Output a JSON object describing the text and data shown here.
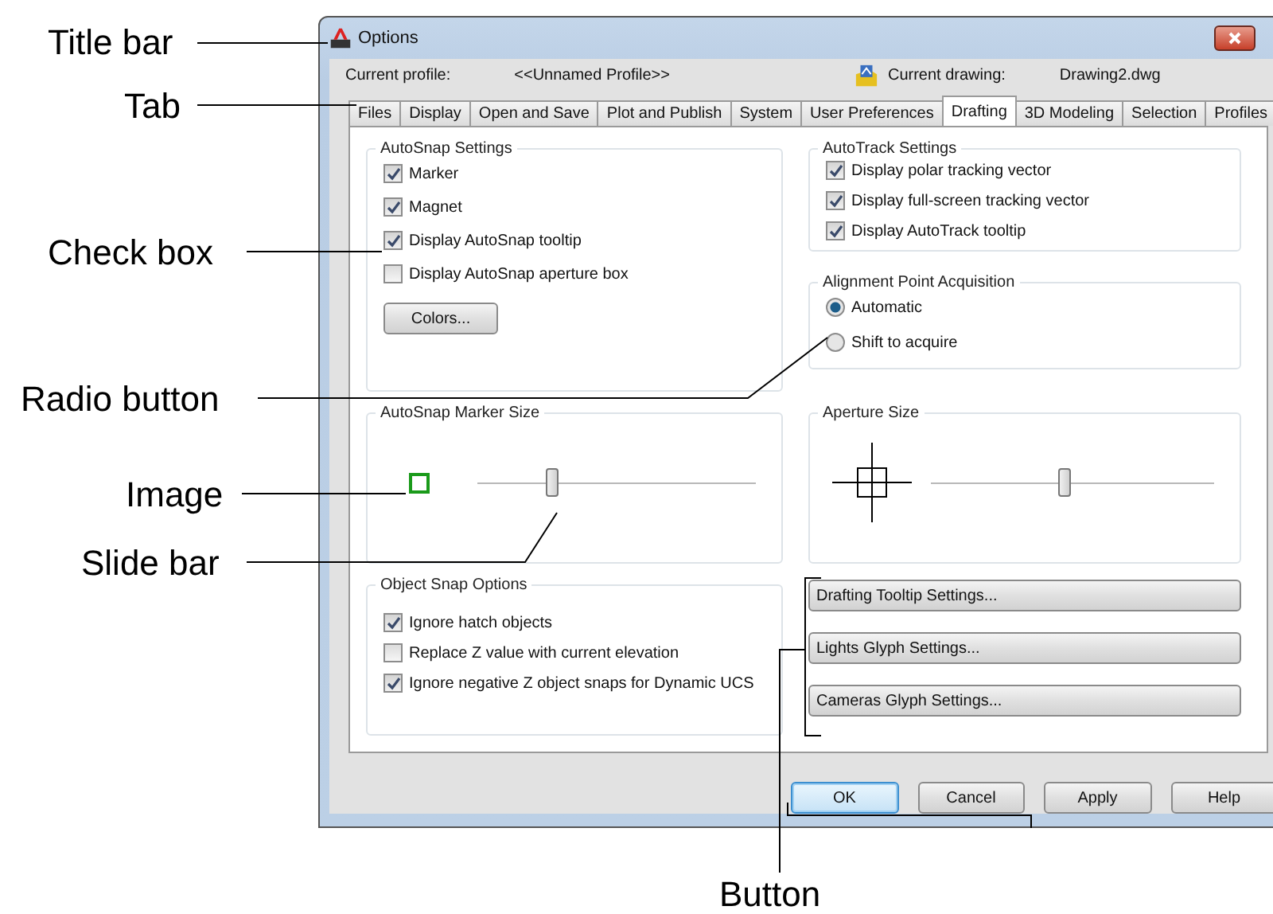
{
  "callouts": [
    {
      "label": "Title bar"
    },
    {
      "label": "Tab"
    },
    {
      "label": "Check box"
    },
    {
      "label": "Radio button"
    },
    {
      "label": "Image"
    },
    {
      "label": "Slide bar"
    },
    {
      "label": "Button"
    }
  ],
  "window": {
    "title": "Options"
  },
  "profile": {
    "label": "Current profile:",
    "value": "<<Unnamed Profile>>"
  },
  "drawing": {
    "label": "Current drawing:",
    "value": "Drawing2.dwg"
  },
  "tabs": [
    {
      "label": "Files",
      "selected": false
    },
    {
      "label": "Display",
      "selected": false
    },
    {
      "label": "Open and Save",
      "selected": false
    },
    {
      "label": "Plot and Publish",
      "selected": false
    },
    {
      "label": "System",
      "selected": false
    },
    {
      "label": "User Preferences",
      "selected": false
    },
    {
      "label": "Drafting",
      "selected": true
    },
    {
      "label": "3D Modeling",
      "selected": false
    },
    {
      "label": "Selection",
      "selected": false
    },
    {
      "label": "Profiles",
      "selected": false
    }
  ],
  "autosnap_settings": {
    "title": "AutoSnap Settings",
    "checkboxes": [
      {
        "label": "Marker",
        "checked": true
      },
      {
        "label": "Magnet",
        "checked": true
      },
      {
        "label": "Display AutoSnap tooltip",
        "checked": true
      },
      {
        "label": "Display AutoSnap aperture box",
        "checked": false
      }
    ],
    "button": "Colors..."
  },
  "autotrack_settings": {
    "title": "AutoTrack Settings",
    "checkboxes": [
      {
        "label": "Display polar tracking vector",
        "checked": true
      },
      {
        "label": "Display full-screen tracking vector",
        "checked": true
      },
      {
        "label": "Display AutoTrack tooltip",
        "checked": true
      }
    ]
  },
  "alignment_point_acquisition": {
    "title": "Alignment Point Acquisition",
    "radios": [
      {
        "label": "Automatic",
        "selected": true
      },
      {
        "label": "Shift to acquire",
        "selected": false
      }
    ]
  },
  "autosnap_marker_size": {
    "title": "AutoSnap Marker Size",
    "level": 0.27
  },
  "aperture_size": {
    "title": "Aperture Size",
    "level": 0.47
  },
  "object_snap_options": {
    "title": "Object Snap Options",
    "checkboxes": [
      {
        "label": "Ignore hatch objects",
        "checked": true
      },
      {
        "label": "Replace Z value with current elevation",
        "checked": false
      },
      {
        "label": "Ignore negative Z object snaps for Dynamic UCS",
        "checked": true
      }
    ]
  },
  "side_buttons": [
    {
      "label": "Drafting Tooltip Settings..."
    },
    {
      "label": "Lights Glyph Settings..."
    },
    {
      "label": "Cameras Glyph Settings..."
    }
  ],
  "footer_buttons": [
    {
      "label": "OK",
      "default": true
    },
    {
      "label": "Cancel",
      "default": false
    },
    {
      "label": "Apply",
      "default": false
    },
    {
      "label": "Help",
      "default": false
    }
  ]
}
